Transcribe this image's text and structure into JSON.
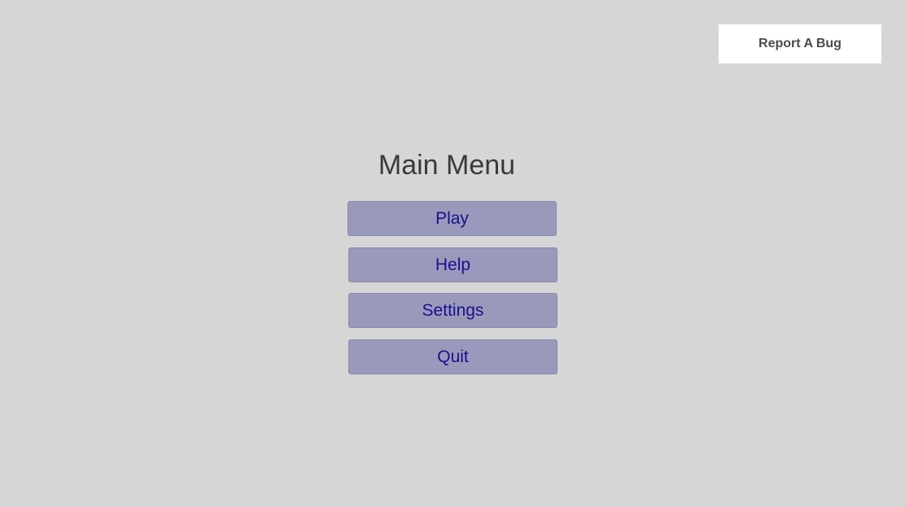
{
  "header": {
    "report_bug_label": "Report A Bug"
  },
  "main_menu": {
    "title": "Main Menu",
    "buttons": [
      {
        "label": "Play"
      },
      {
        "label": "Help"
      },
      {
        "label": "Settings"
      },
      {
        "label": "Quit"
      }
    ]
  },
  "colors": {
    "background": "#d6d6d6",
    "button_fill": "#9999bb",
    "button_text": "#1a0f8f",
    "title_text": "#3a3a3a",
    "report_button_fill": "#ffffff"
  }
}
